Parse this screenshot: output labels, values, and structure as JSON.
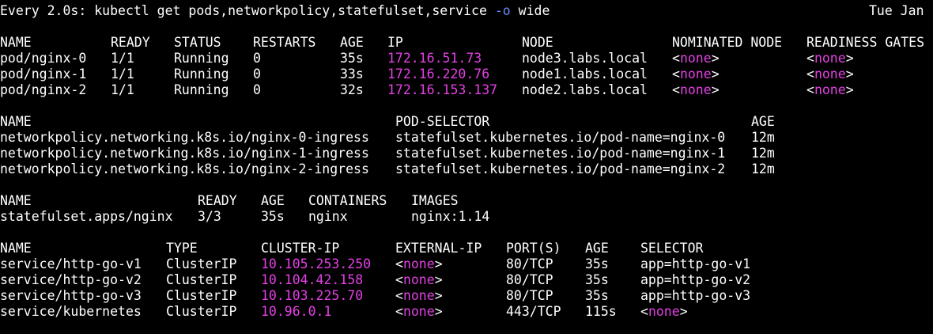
{
  "header": {
    "prefix": "Every 2.0s: kubectl get pods,networkpolicy,statefulset,service ",
    "flag": "-o",
    "suffix": " wide",
    "date": "Tue Jan"
  },
  "none_token": {
    "open": "<",
    "word": "none",
    "close": ">"
  },
  "pods": {
    "headers": [
      "NAME",
      "READY",
      "STATUS",
      "RESTARTS",
      "AGE",
      "IP",
      "NODE",
      "NOMINATED NODE",
      "READINESS GATES"
    ],
    "rows": [
      {
        "name": "pod/nginx-0",
        "ready": "1/1",
        "status": "Running",
        "restarts": "0",
        "age": "35s",
        "ip": "172.16.51.73",
        "node": "node3.labs.local"
      },
      {
        "name": "pod/nginx-1",
        "ready": "1/1",
        "status": "Running",
        "restarts": "0",
        "age": "33s",
        "ip": "172.16.220.76",
        "node": "node1.labs.local"
      },
      {
        "name": "pod/nginx-2",
        "ready": "1/1",
        "status": "Running",
        "restarts": "0",
        "age": "32s",
        "ip": "172.16.153.137",
        "node": "node2.labs.local"
      }
    ]
  },
  "networkpolicies": {
    "headers": [
      "NAME",
      "POD-SELECTOR",
      "AGE"
    ],
    "rows": [
      {
        "name": "networkpolicy.networking.k8s.io/nginx-0-ingress",
        "selector": "statefulset.kubernetes.io/pod-name=nginx-0",
        "age": "12m"
      },
      {
        "name": "networkpolicy.networking.k8s.io/nginx-1-ingress",
        "selector": "statefulset.kubernetes.io/pod-name=nginx-1",
        "age": "12m"
      },
      {
        "name": "networkpolicy.networking.k8s.io/nginx-2-ingress",
        "selector": "statefulset.kubernetes.io/pod-name=nginx-2",
        "age": "12m"
      }
    ]
  },
  "statefulsets": {
    "headers": [
      "NAME",
      "READY",
      "AGE",
      "CONTAINERS",
      "IMAGES"
    ],
    "rows": [
      {
        "name": "statefulset.apps/nginx",
        "ready": "3/3",
        "age": "35s",
        "containers": "nginx",
        "images": "nginx:1.14"
      }
    ]
  },
  "services": {
    "headers": [
      "NAME",
      "TYPE",
      "CLUSTER-IP",
      "EXTERNAL-IP",
      "PORT(S)",
      "AGE",
      "SELECTOR"
    ],
    "rows": [
      {
        "name": "service/http-go-v1",
        "type": "ClusterIP",
        "cluster_ip": "10.105.253.250",
        "port": "80/TCP",
        "age": "35s",
        "selector": "app=http-go-v1"
      },
      {
        "name": "service/http-go-v2",
        "type": "ClusterIP",
        "cluster_ip": "10.104.42.158",
        "port": "80/TCP",
        "age": "35s",
        "selector": "app=http-go-v2"
      },
      {
        "name": "service/http-go-v3",
        "type": "ClusterIP",
        "cluster_ip": "10.103.225.70",
        "port": "80/TCP",
        "age": "35s",
        "selector": "app=http-go-v3"
      },
      {
        "name": "service/kubernetes",
        "type": "ClusterIP",
        "cluster_ip": "10.96.0.1",
        "port": "443/TCP",
        "age": "115s",
        "selector": ""
      }
    ]
  },
  "colors": {
    "ip": "#e540e5",
    "flag": "#6b88ff",
    "text": "#ffffff",
    "background": "#000000"
  }
}
